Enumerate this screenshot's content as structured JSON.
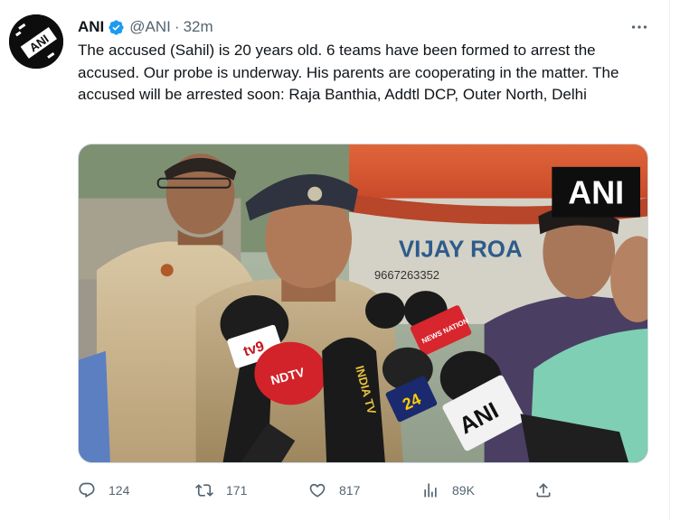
{
  "account": {
    "display_name": "ANI",
    "handle": "@ANI",
    "separator": "·",
    "time_ago": "32m",
    "verified": true,
    "avatar_text": "ANI"
  },
  "tweet": {
    "text": "The accused (Sahil) is 20 years old. 6 teams have been formed to arrest the accused. Our probe is underway. His parents are cooperating in the matter. The accused will be arrested soon: Raja Banthia, Addtl DCP, Outer North, Delhi"
  },
  "media": {
    "watermark": "ANI",
    "truck_sign": "VIJAY ROA",
    "truck_phone": "9667263352",
    "mic_labels": [
      "tv9",
      "NDTV",
      "INDIA TV",
      "NEWS NATION",
      "24",
      "ANI"
    ]
  },
  "actions": {
    "replies": "124",
    "retweets": "171",
    "likes": "817",
    "views": "89K"
  },
  "icons": {
    "more": "more-icon",
    "reply": "reply-icon",
    "retweet": "retweet-icon",
    "like": "like-icon",
    "views": "views-icon",
    "share": "share-icon",
    "verified": "verified-badge-icon"
  },
  "colors": {
    "verified": "#1d9bf0",
    "secondary_text": "#536471",
    "primary_text": "#0f1419"
  }
}
